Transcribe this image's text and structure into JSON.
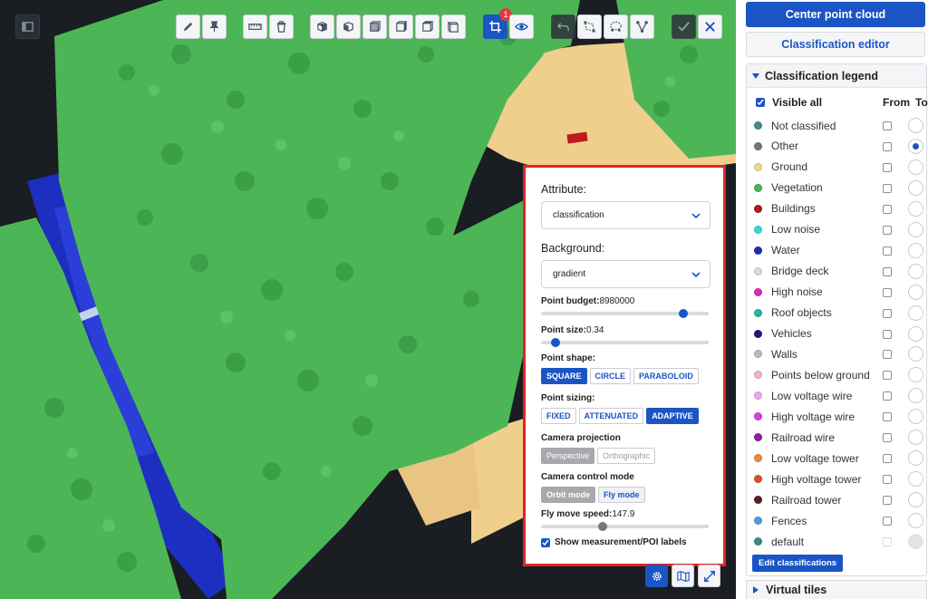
{
  "toolbar": {
    "tools": [
      {
        "icon": "pencil-icon"
      },
      {
        "icon": "pin-icon"
      },
      {
        "icon": "ruler-icon"
      },
      {
        "icon": "trash-icon"
      },
      {
        "icon": "cube-front-icon"
      },
      {
        "icon": "cube-left-icon"
      },
      {
        "icon": "cube-right-icon"
      },
      {
        "icon": "cube-top-icon"
      },
      {
        "icon": "cube-back-icon"
      },
      {
        "icon": "cube-bottom-icon"
      },
      {
        "icon": "crop-icon"
      },
      {
        "icon": "eye-icon"
      },
      {
        "icon": "undo-icon"
      },
      {
        "icon": "polygon-select-icon"
      },
      {
        "icon": "lasso-select-icon"
      },
      {
        "icon": "vertex-icon"
      },
      {
        "icon": "check-icon"
      },
      {
        "icon": "close-icon"
      }
    ],
    "crop_badge": "1"
  },
  "settings": {
    "attribute_label": "Attribute:",
    "attribute_value": "classification",
    "background_label": "Background:",
    "background_value": "gradient",
    "point_budget_label": "Point budget:",
    "point_budget_value": "8980000",
    "point_budget_fraction": 0.87,
    "point_size_label": "Point size:",
    "point_size_value": "0.34",
    "point_size_fraction": 0.06,
    "point_shape_label": "Point shape:",
    "point_shape_options": [
      "SQUARE",
      "CIRCLE",
      "PARABOLOID"
    ],
    "point_shape_selected": "SQUARE",
    "point_sizing_label": "Point sizing:",
    "point_sizing_options": [
      "FIXED",
      "ATTENUATED",
      "ADAPTIVE"
    ],
    "point_sizing_selected": "ADAPTIVE",
    "camera_projection_label": "Camera projection",
    "camera_projection_options": [
      "Perspective",
      "Orthographic"
    ],
    "camera_control_label": "Camera control mode",
    "camera_control_options": [
      "Orbit mode",
      "Fly mode"
    ],
    "fly_speed_label": "Fly move speed:",
    "fly_speed_value": "147.9",
    "fly_speed_fraction": 0.36,
    "show_labels_text": "Show measurement/POI labels",
    "show_labels_checked": true
  },
  "sidebar": {
    "center_button": "Center point cloud",
    "editor_button": "Classification editor",
    "legend_title": "Classification legend",
    "visible_all": "Visible all",
    "col_from": "From",
    "col_to": "To",
    "classes": [
      {
        "name": "Not classified",
        "color": "#3f8f8c",
        "to_selected": false
      },
      {
        "name": "Other",
        "color": "#6f7680",
        "to_selected": true
      },
      {
        "name": "Ground",
        "color": "#ecd893",
        "to_selected": false
      },
      {
        "name": "Vegetation",
        "color": "#4cb656",
        "to_selected": false
      },
      {
        "name": "Buildings",
        "color": "#b11b1b",
        "to_selected": false
      },
      {
        "name": "Low noise",
        "color": "#34d9e0",
        "to_selected": false
      },
      {
        "name": "Water",
        "color": "#1d2fa8",
        "to_selected": false
      },
      {
        "name": "Bridge deck",
        "color": "#d6d9ec",
        "to_selected": false
      },
      {
        "name": "High noise",
        "color": "#e226b5",
        "to_selected": false
      },
      {
        "name": "Roof objects",
        "color": "#1fb7a6",
        "to_selected": false
      },
      {
        "name": "Vehicles",
        "color": "#1a1a7a",
        "to_selected": false
      },
      {
        "name": "Walls",
        "color": "#b9bcc8",
        "to_selected": false
      },
      {
        "name": "Points below ground",
        "color": "#f2b5c0",
        "to_selected": false
      },
      {
        "name": "Low voltage wire",
        "color": "#e9a8ee",
        "to_selected": false
      },
      {
        "name": "High voltage wire",
        "color": "#d63fe0",
        "to_selected": false
      },
      {
        "name": "Railroad wire",
        "color": "#8e1f9e",
        "to_selected": false
      },
      {
        "name": "Low voltage tower",
        "color": "#f08a3c",
        "to_selected": false
      },
      {
        "name": "High voltage tower",
        "color": "#d9531e",
        "to_selected": false
      },
      {
        "name": "Railroad tower",
        "color": "#5a1f23",
        "to_selected": false
      },
      {
        "name": "Fences",
        "color": "#5b98d6",
        "to_selected": false
      },
      {
        "name": "default",
        "color": "#3b8c82",
        "to_selected": false,
        "disabled": true
      }
    ],
    "edit_button": "Edit classifications",
    "virtual_tiles": "Virtual tiles"
  },
  "corner": [
    {
      "icon": "settings-icon"
    },
    {
      "icon": "map-icon"
    },
    {
      "icon": "fullscreen-icon"
    }
  ],
  "colors": {
    "accent": "#1b55c5",
    "vegetation": "#4cb656",
    "ground": "#f0cf8c",
    "water": "#1d2fc0",
    "panel_border": "#e02424"
  }
}
